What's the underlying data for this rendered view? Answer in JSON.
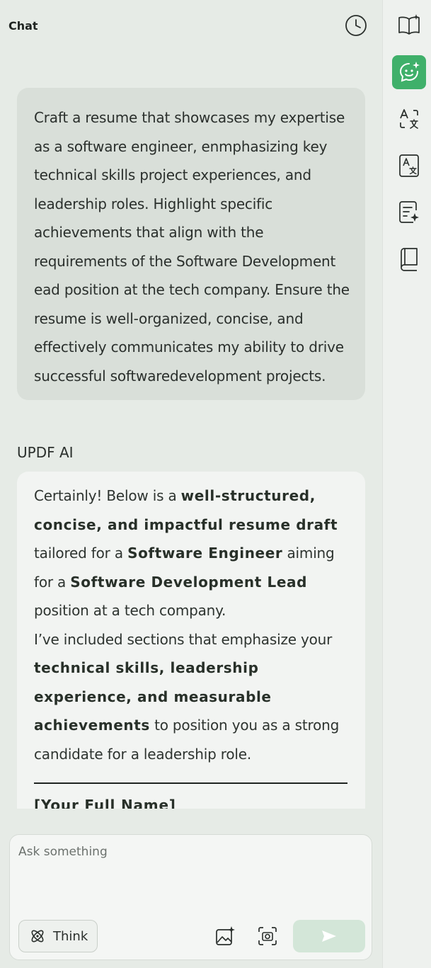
{
  "header": {
    "title": "Chat"
  },
  "user_message": {
    "text": "Craft a resume that showcases my expertise as a software engineer, enmphasizing key technical skills project experiences, and leadership roles. Highlight specific achievements that align with the requirements of the Software Development ead position at the tech company. Ensure the resume is well-organized, concise, and effectively communicates my ability to drive successful softwaredevelopment projects."
  },
  "ai_response": {
    "label": "UPDF AI",
    "intro_1": "Certainly! Below is a ",
    "intro_bold_1": "well-structured, concise, and impactful resume draft",
    "intro_2": " tailored for a ",
    "intro_bold_2": "Software Engineer",
    "intro_3": " aiming for a ",
    "intro_bold_3": "Software Development Lead",
    "intro_4": " position at a tech company.",
    "para2_1": "I’ve included sections that emphasize your ",
    "para2_bold": "technical skills, leadership experience, and measurable achievements",
    "para2_2": " to position you as a strong candidate for a leadership role.",
    "cut_off_line": "[Your Full Name]"
  },
  "composer": {
    "placeholder": "Ask something",
    "think_label": "Think"
  },
  "colors": {
    "accent": "#3fb06a",
    "send_disabled": "#d3e6d8"
  },
  "icons": {
    "history": "clock-icon",
    "rail": [
      "book-open-icon",
      "ai-chat-icon",
      "translate-icon",
      "translate-page-icon",
      "summary-icon",
      "library-icon"
    ],
    "think": "atom-icon",
    "image": "image-spark-icon",
    "screenshot": "camera-icon",
    "send": "send-icon"
  }
}
